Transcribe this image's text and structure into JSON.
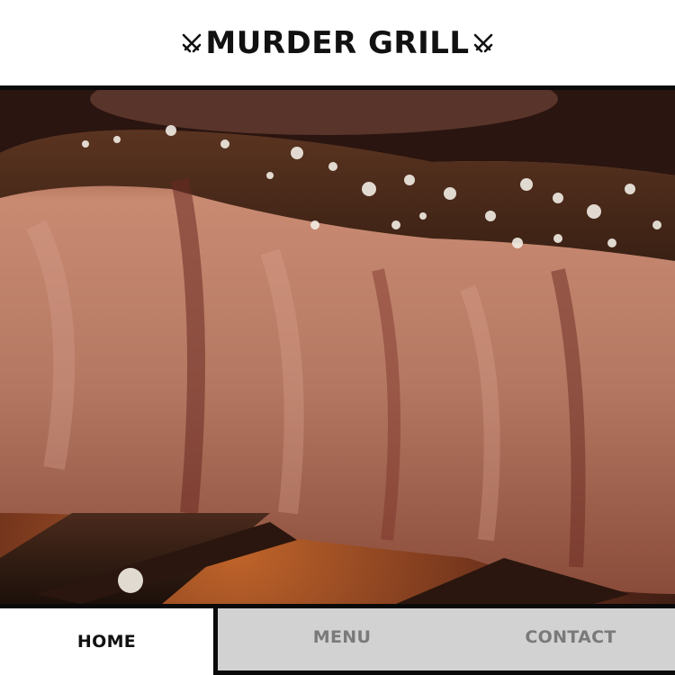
{
  "brand": {
    "name": "MURDER GRILL",
    "icon": "crossed-swords-icon"
  },
  "hero": {
    "image": "grilled-steak-photo"
  },
  "nav": {
    "home_label": "HOME",
    "menu_label": "MENU",
    "contact_label": "CONTACT"
  },
  "colors": {
    "header_bg": "#ffffff",
    "text_dark": "#111111",
    "border_black": "#0a0a0a",
    "tab_inactive_bg": "#d2d2d2",
    "tab_inactive_text": "#7a7a7a"
  }
}
